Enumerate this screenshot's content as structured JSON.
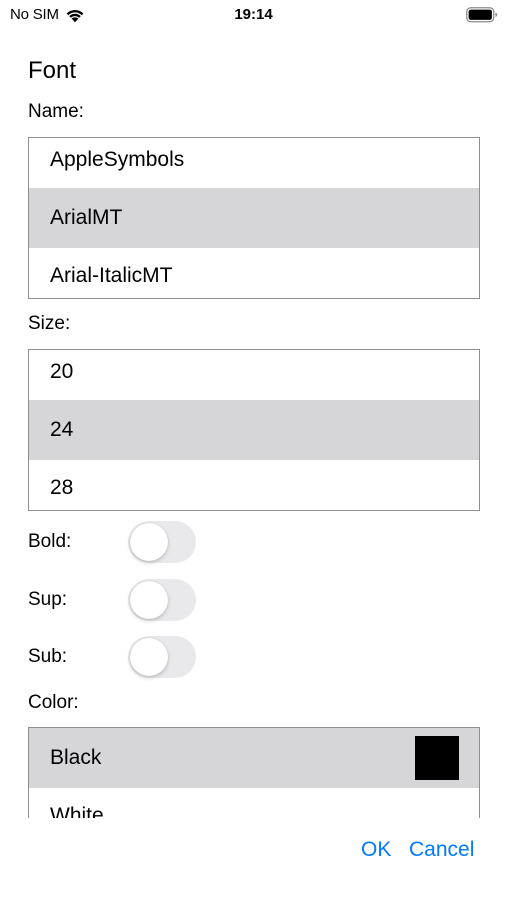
{
  "status_bar": {
    "carrier": "No SIM",
    "time": "19:14"
  },
  "title": "Font",
  "name": {
    "label": "Name:",
    "rows": [
      "AppleSymbols",
      "ArialMT",
      "Arial-ItalicMT"
    ],
    "selected": "ArialMT"
  },
  "size": {
    "label": "Size:",
    "rows": [
      "20",
      "24",
      "28"
    ],
    "selected": "24"
  },
  "toggles": {
    "bold": {
      "label": "Bold:",
      "on": false
    },
    "sup": {
      "label": "Sup:",
      "on": false
    },
    "sub": {
      "label": "Sub:",
      "on": false
    }
  },
  "color": {
    "label": "Color:",
    "rows": [
      "Black",
      "White"
    ],
    "selected": "Black",
    "swatch_hex": "#000000"
  },
  "buttons": {
    "ok": "OK",
    "cancel": "Cancel"
  },
  "theme": {
    "accent": "#007aff",
    "selection_bg": "#d6d6d9",
    "toggle_off_bg": "#e9e9eb",
    "border": "#8e8e93"
  }
}
